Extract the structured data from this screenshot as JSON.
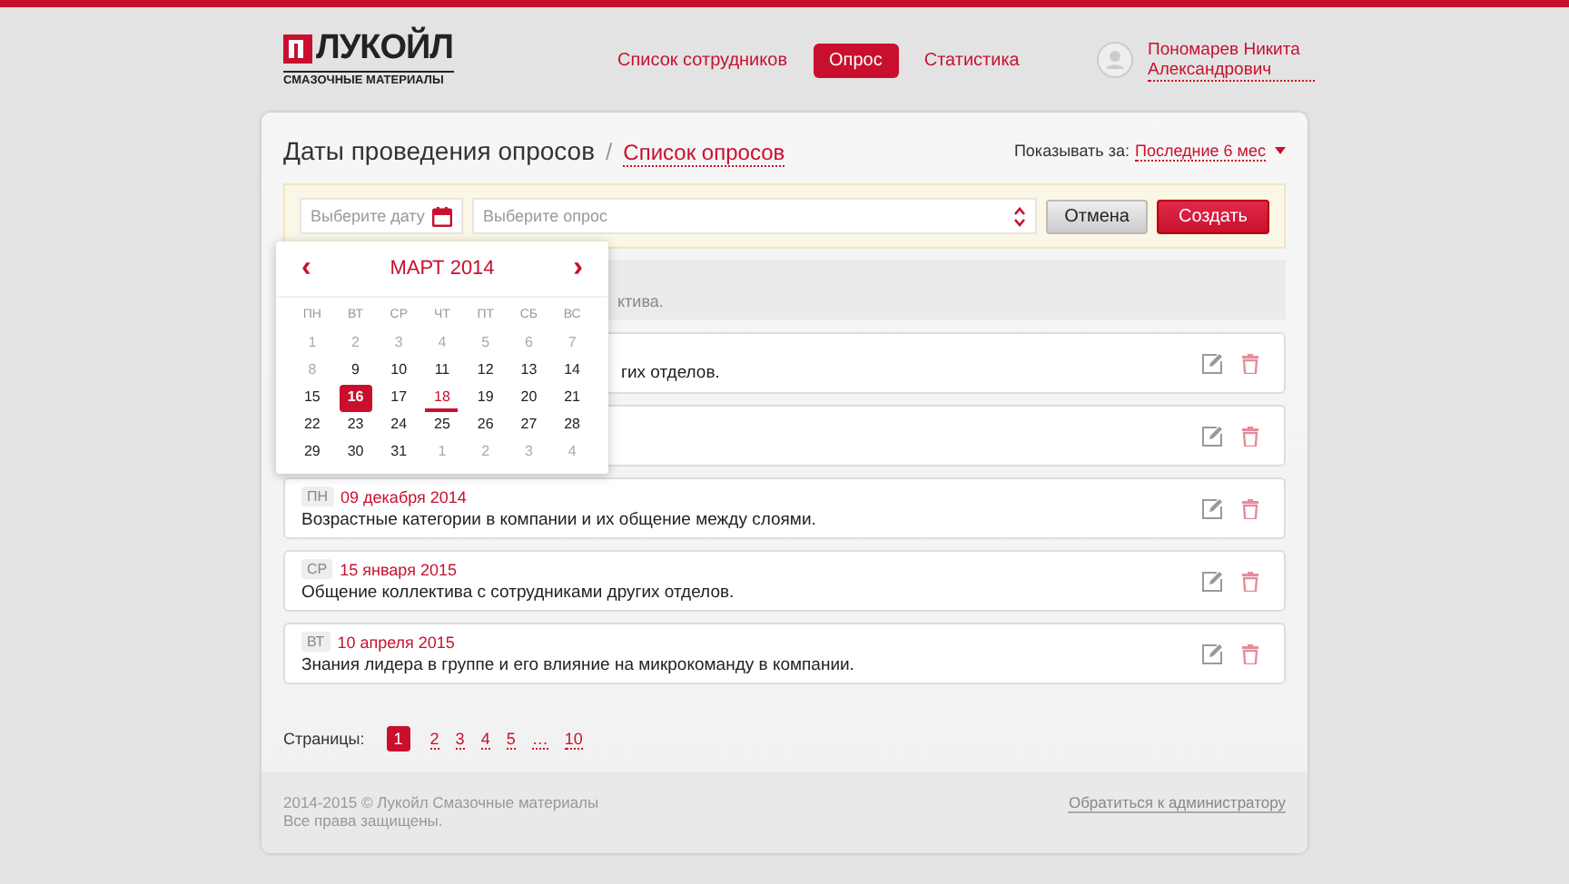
{
  "logo": {
    "name": "ЛУКОЙЛ",
    "subtitle": "СМАЗОЧНЫЕ МАТЕРИАЛЫ"
  },
  "nav": [
    {
      "label": "Список сотрудников",
      "selected": false
    },
    {
      "label": "Опрос",
      "selected": true
    },
    {
      "label": "Статистика",
      "selected": false
    }
  ],
  "user": {
    "name": "Пономарев Никита Александрович"
  },
  "page": {
    "title": "Даты проведения опросов",
    "separator": "/",
    "link": "Список опросов",
    "filter_label": "Показывать за:",
    "filter_value": "Последние 6 мес"
  },
  "form": {
    "date_placeholder": "Выберите дату",
    "survey_placeholder": "Выберите опрос",
    "cancel": "Отмена",
    "create": "Создать"
  },
  "calendar": {
    "month": "МАРТ 2014",
    "prev": "‹",
    "next": "›",
    "weekdays": [
      "ПН",
      "ВТ",
      "СР",
      "ЧТ",
      "ПТ",
      "СБ",
      "ВС"
    ],
    "weeks": [
      [
        {
          "d": "1",
          "muted": true,
          "selected": false,
          "today": false
        },
        {
          "d": "2",
          "muted": true,
          "selected": false,
          "today": false
        },
        {
          "d": "3",
          "muted": true,
          "selected": false,
          "today": false
        },
        {
          "d": "4",
          "muted": true,
          "selected": false,
          "today": false
        },
        {
          "d": "5",
          "muted": true,
          "selected": false,
          "today": false
        },
        {
          "d": "6",
          "muted": true,
          "selected": false,
          "today": false
        },
        {
          "d": "7",
          "muted": true,
          "selected": false,
          "today": false
        }
      ],
      [
        {
          "d": "8",
          "muted": true,
          "selected": false,
          "today": false
        },
        {
          "d": "9",
          "muted": false,
          "selected": false,
          "today": false
        },
        {
          "d": "10",
          "muted": false,
          "selected": false,
          "today": false
        },
        {
          "d": "11",
          "muted": false,
          "selected": false,
          "today": false
        },
        {
          "d": "12",
          "muted": false,
          "selected": false,
          "today": false
        },
        {
          "d": "13",
          "muted": false,
          "selected": false,
          "today": false
        },
        {
          "d": "14",
          "muted": false,
          "selected": false,
          "today": false
        }
      ],
      [
        {
          "d": "15",
          "muted": false,
          "selected": false,
          "today": false
        },
        {
          "d": "16",
          "muted": false,
          "selected": true,
          "today": false
        },
        {
          "d": "17",
          "muted": false,
          "selected": false,
          "today": false
        },
        {
          "d": "18",
          "muted": false,
          "selected": false,
          "today": true
        },
        {
          "d": "19",
          "muted": false,
          "selected": false,
          "today": false
        },
        {
          "d": "20",
          "muted": false,
          "selected": false,
          "today": false
        },
        {
          "d": "21",
          "muted": false,
          "selected": false,
          "today": false
        }
      ],
      [
        {
          "d": "22",
          "muted": false,
          "selected": false,
          "today": false
        },
        {
          "d": "23",
          "muted": false,
          "selected": false,
          "today": false
        },
        {
          "d": "24",
          "muted": false,
          "selected": false,
          "today": false
        },
        {
          "d": "25",
          "muted": false,
          "selected": false,
          "today": false
        },
        {
          "d": "26",
          "muted": false,
          "selected": false,
          "today": false
        },
        {
          "d": "27",
          "muted": false,
          "selected": false,
          "today": false
        },
        {
          "d": "28",
          "muted": false,
          "selected": false,
          "today": false
        }
      ],
      [
        {
          "d": "29",
          "muted": false,
          "selected": false,
          "today": false
        },
        {
          "d": "30",
          "muted": false,
          "selected": false,
          "today": false
        },
        {
          "d": "31",
          "muted": false,
          "selected": false,
          "today": false
        },
        {
          "d": "1",
          "muted": true,
          "selected": false,
          "today": false
        },
        {
          "d": "2",
          "muted": true,
          "selected": false,
          "today": false
        },
        {
          "d": "3",
          "muted": true,
          "selected": false,
          "today": false
        },
        {
          "d": "4",
          "muted": true,
          "selected": false,
          "today": false
        }
      ]
    ]
  },
  "notice": {
    "text": "ктива."
  },
  "surveys": [
    {
      "kind": "entry",
      "text": "гих отделов."
    },
    {
      "kind": "covered"
    },
    {
      "kind": "entry",
      "weekday": "ПН",
      "date": "09 декабря 2014",
      "text": "Возрастные категории в компании и их общение между слоями."
    },
    {
      "kind": "entry",
      "weekday": "СР",
      "date": "15 января 2015",
      "text": "Общение коллектива с сотрудниками других отделов."
    },
    {
      "kind": "entry",
      "weekday": "ВТ",
      "date": "10 апреля 2015",
      "text": "Знания лидера в группе и его влияние на микрокоманду в компании."
    }
  ],
  "pagination": {
    "label": "Страницы:",
    "pages": [
      {
        "label": "1",
        "selected": true
      },
      {
        "label": "2",
        "selected": false
      },
      {
        "label": "3",
        "selected": false
      },
      {
        "label": "4",
        "selected": false
      },
      {
        "label": "5",
        "selected": false
      },
      {
        "label": "…",
        "selected": false
      },
      {
        "label": "10",
        "selected": false
      }
    ]
  },
  "footer": {
    "copyright": "2014-2015 © Лукойл Смазочные материалы",
    "rights": "Все права защищены.",
    "contact": "Обратиться к администратору"
  }
}
